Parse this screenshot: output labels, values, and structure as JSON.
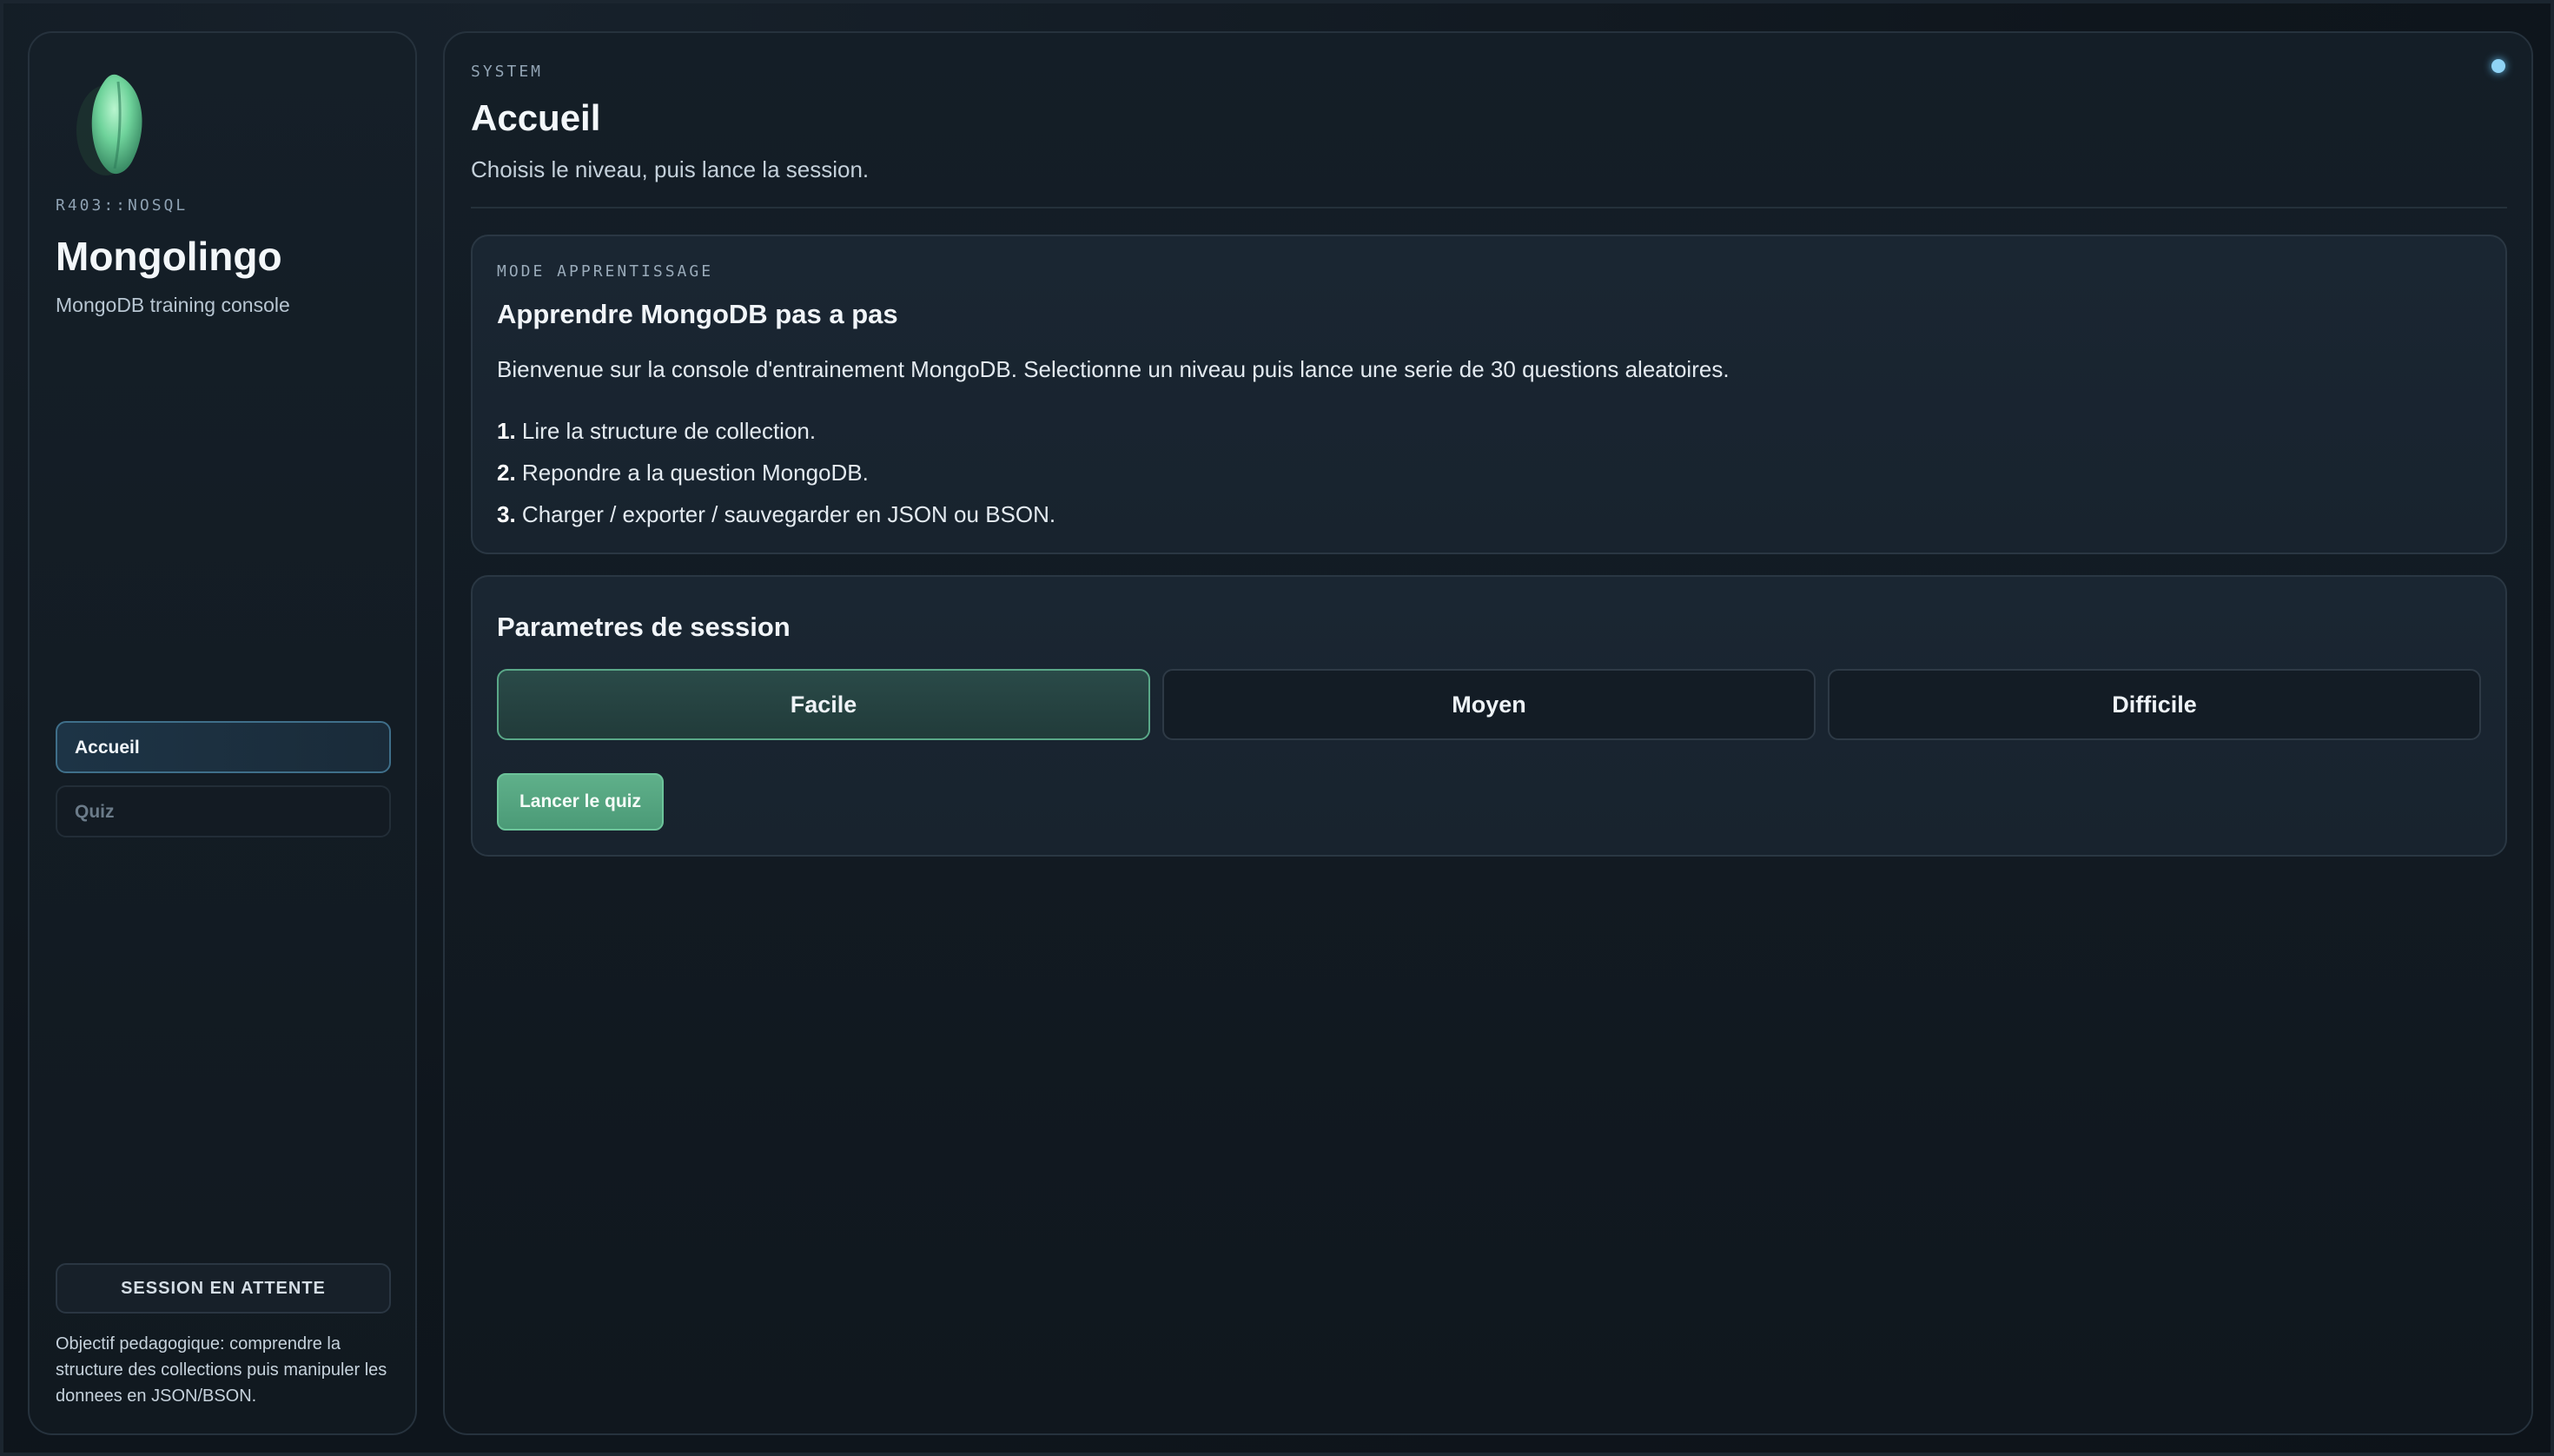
{
  "sidebar": {
    "brand_code": "R403::NOSQL",
    "brand_name": "Mongolingo",
    "brand_sub": "MongoDB training console",
    "nav": [
      {
        "label": "Accueil",
        "active": true
      },
      {
        "label": "Quiz",
        "active": false
      }
    ],
    "session_status": "SESSION EN ATTENTE",
    "objective": "Objectif pedagogique: comprendre la structure des collections puis manipuler les donnees en JSON/BSON."
  },
  "header": {
    "section_label": "SYSTEM",
    "title": "Accueil",
    "subtitle": "Choisis le niveau, puis lance la session."
  },
  "learn_card": {
    "kicker": "MODE APPRENTISSAGE",
    "title": "Apprendre MongoDB pas a pas",
    "intro": "Bienvenue sur la console d'entrainement MongoDB. Selectionne un niveau puis lance une serie de 30 questions aleatoires.",
    "steps": [
      {
        "num": "1.",
        "text": "Lire la structure de collection."
      },
      {
        "num": "2.",
        "text": "Repondre a la question MongoDB."
      },
      {
        "num": "3.",
        "text": "Charger / exporter / sauvegarder en JSON ou BSON."
      }
    ]
  },
  "session_card": {
    "title": "Parametres de session",
    "levels": [
      {
        "label": "Facile",
        "selected": true
      },
      {
        "label": "Moyen",
        "selected": false
      },
      {
        "label": "Difficile",
        "selected": false
      }
    ],
    "launch_label": "Lancer le quiz"
  },
  "colors": {
    "accent_green": "#5fb08a",
    "accent_blue": "#8fd3f5",
    "background": "#0f161d"
  }
}
